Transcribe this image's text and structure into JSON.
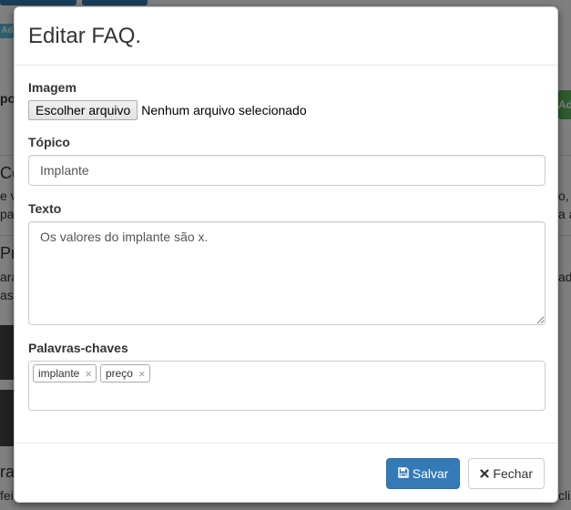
{
  "background": {
    "tag_text": "Ad",
    "side_button_text": "Ad",
    "fragments": [
      "po",
      "Co",
      "e v",
      "pa",
      "Pre",
      "ara",
      "as",
      "ra",
      "fei",
      "o,",
      "a a",
      "ado",
      "cli"
    ]
  },
  "modal": {
    "title": "Editar FAQ.",
    "image": {
      "label": "Imagem",
      "button_label": "Escolher arquivo",
      "status": "Nenhum arquivo selecionado"
    },
    "topic": {
      "label": "Tópico",
      "value": "Implante"
    },
    "text": {
      "label": "Texto",
      "value": "Os valores do implante são x."
    },
    "keywords": {
      "label": "Palavras-chaves",
      "tags": [
        {
          "label": "implante",
          "remove": "×"
        },
        {
          "label": "preço",
          "remove": "×"
        }
      ]
    },
    "footer": {
      "save_label": "Salvar",
      "close_label": "Fechar",
      "save_icon": "floppy-disk-icon",
      "close_icon": "close-icon"
    }
  },
  "colors": {
    "primary": "#337ab7",
    "backdrop": "rgba(0,0,0,0.5)"
  }
}
